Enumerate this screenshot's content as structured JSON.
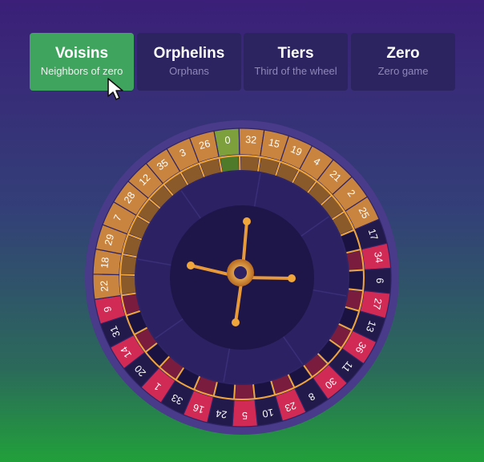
{
  "tabs": [
    {
      "title": "Voisins",
      "subtitle": "Neighbors of zero",
      "active": true
    },
    {
      "title": "Orphelins",
      "subtitle": "Orphans",
      "active": false
    },
    {
      "title": "Tiers",
      "subtitle": "Third of the wheel",
      "active": false
    },
    {
      "title": "Zero",
      "subtitle": "Zero game",
      "active": false
    }
  ],
  "wheel": {
    "pockets": [
      {
        "n": "0",
        "color": "green"
      },
      {
        "n": "32",
        "color": "red"
      },
      {
        "n": "15",
        "color": "black"
      },
      {
        "n": "19",
        "color": "red"
      },
      {
        "n": "4",
        "color": "black"
      },
      {
        "n": "21",
        "color": "red"
      },
      {
        "n": "2",
        "color": "black"
      },
      {
        "n": "25",
        "color": "red"
      },
      {
        "n": "17",
        "color": "black"
      },
      {
        "n": "34",
        "color": "red"
      },
      {
        "n": "6",
        "color": "black"
      },
      {
        "n": "27",
        "color": "red"
      },
      {
        "n": "13",
        "color": "black"
      },
      {
        "n": "36",
        "color": "red"
      },
      {
        "n": "11",
        "color": "black"
      },
      {
        "n": "30",
        "color": "red"
      },
      {
        "n": "8",
        "color": "black"
      },
      {
        "n": "23",
        "color": "red"
      },
      {
        "n": "10",
        "color": "black"
      },
      {
        "n": "5",
        "color": "red"
      },
      {
        "n": "24",
        "color": "black"
      },
      {
        "n": "16",
        "color": "red"
      },
      {
        "n": "33",
        "color": "black"
      },
      {
        "n": "1",
        "color": "red"
      },
      {
        "n": "20",
        "color": "black"
      },
      {
        "n": "14",
        "color": "red"
      },
      {
        "n": "31",
        "color": "black"
      },
      {
        "n": "9",
        "color": "red"
      },
      {
        "n": "22",
        "color": "black"
      },
      {
        "n": "18",
        "color": "red"
      },
      {
        "n": "29",
        "color": "black"
      },
      {
        "n": "7",
        "color": "red"
      },
      {
        "n": "28",
        "color": "black"
      },
      {
        "n": "12",
        "color": "red"
      },
      {
        "n": "35",
        "color": "black"
      },
      {
        "n": "3",
        "color": "red"
      },
      {
        "n": "26",
        "color": "black"
      }
    ],
    "highlighted": [
      "22",
      "18",
      "29",
      "7",
      "28",
      "12",
      "35",
      "3",
      "26",
      "0",
      "32",
      "15",
      "19",
      "4",
      "21",
      "2",
      "25"
    ],
    "colors": {
      "green": "#6f9a36",
      "red": "#d12a55",
      "black": "#221a4a",
      "highlight": "#c98540",
      "highlight_zero": "#7ea03c",
      "rim": "#3f2f7a",
      "gold": "#f0a63a"
    }
  }
}
